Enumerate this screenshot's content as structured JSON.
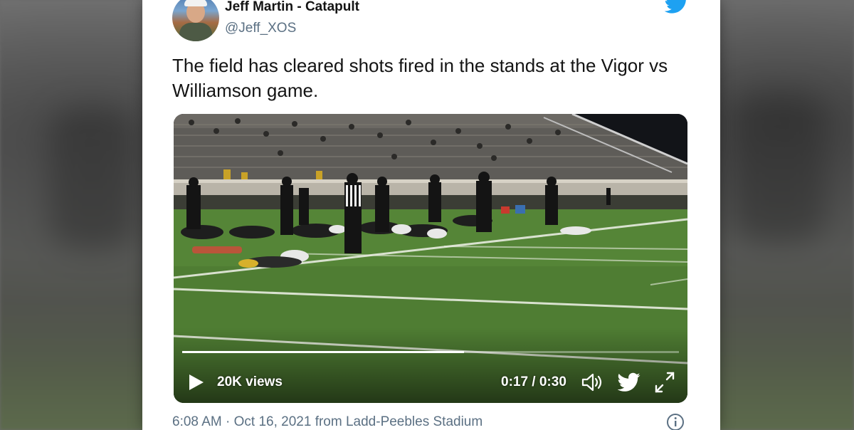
{
  "tweet": {
    "author_name": "Jeff Martin - Catapult",
    "author_handle": "@Jeff_XOS",
    "text": "The field has cleared shots fired in the stands at the Vigor vs Williamson game."
  },
  "video": {
    "views": "20K views",
    "time_current": "0:17",
    "time_total": "0:30",
    "time_display": "0:17 / 0:30",
    "progress_fraction": 0.567
  },
  "meta": {
    "time": "6:08 AM",
    "separator": "·",
    "date": "Oct 16, 2021",
    "source_prefix": "from",
    "location": "Ladd-Peebles Stadium",
    "line": "6:08 AM · Oct 16, 2021 from Ladd-Peebles Stadium"
  },
  "icons": {
    "brand": "twitter-bird-icon",
    "play": "play-icon",
    "volume": "volume-icon",
    "share": "twitter-bird-icon",
    "expand": "expand-icon",
    "info": "info-icon"
  },
  "colors": {
    "twitter_blue": "#1da1f2",
    "muted_text": "#5b7083",
    "text": "#141414"
  }
}
